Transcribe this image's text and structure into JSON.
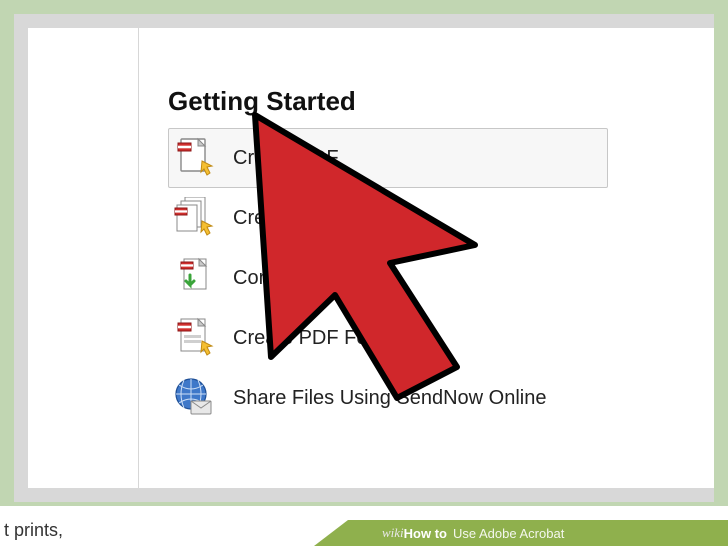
{
  "header": {
    "title": "Getting Started"
  },
  "items": [
    {
      "label": "Create PDF",
      "selected": true
    },
    {
      "label": "Create PDF Po",
      "selected": false
    },
    {
      "label": "Combine Files into",
      "selected": false
    },
    {
      "label": "Create PDF Form",
      "selected": false
    },
    {
      "label": "Share Files Using SendNow Online",
      "selected": false
    }
  ],
  "fragment": {
    "text": "t prints,"
  },
  "brand": {
    "wiki": "wiki",
    "howto": "How to",
    "title": "Use Adobe Acrobat"
  }
}
